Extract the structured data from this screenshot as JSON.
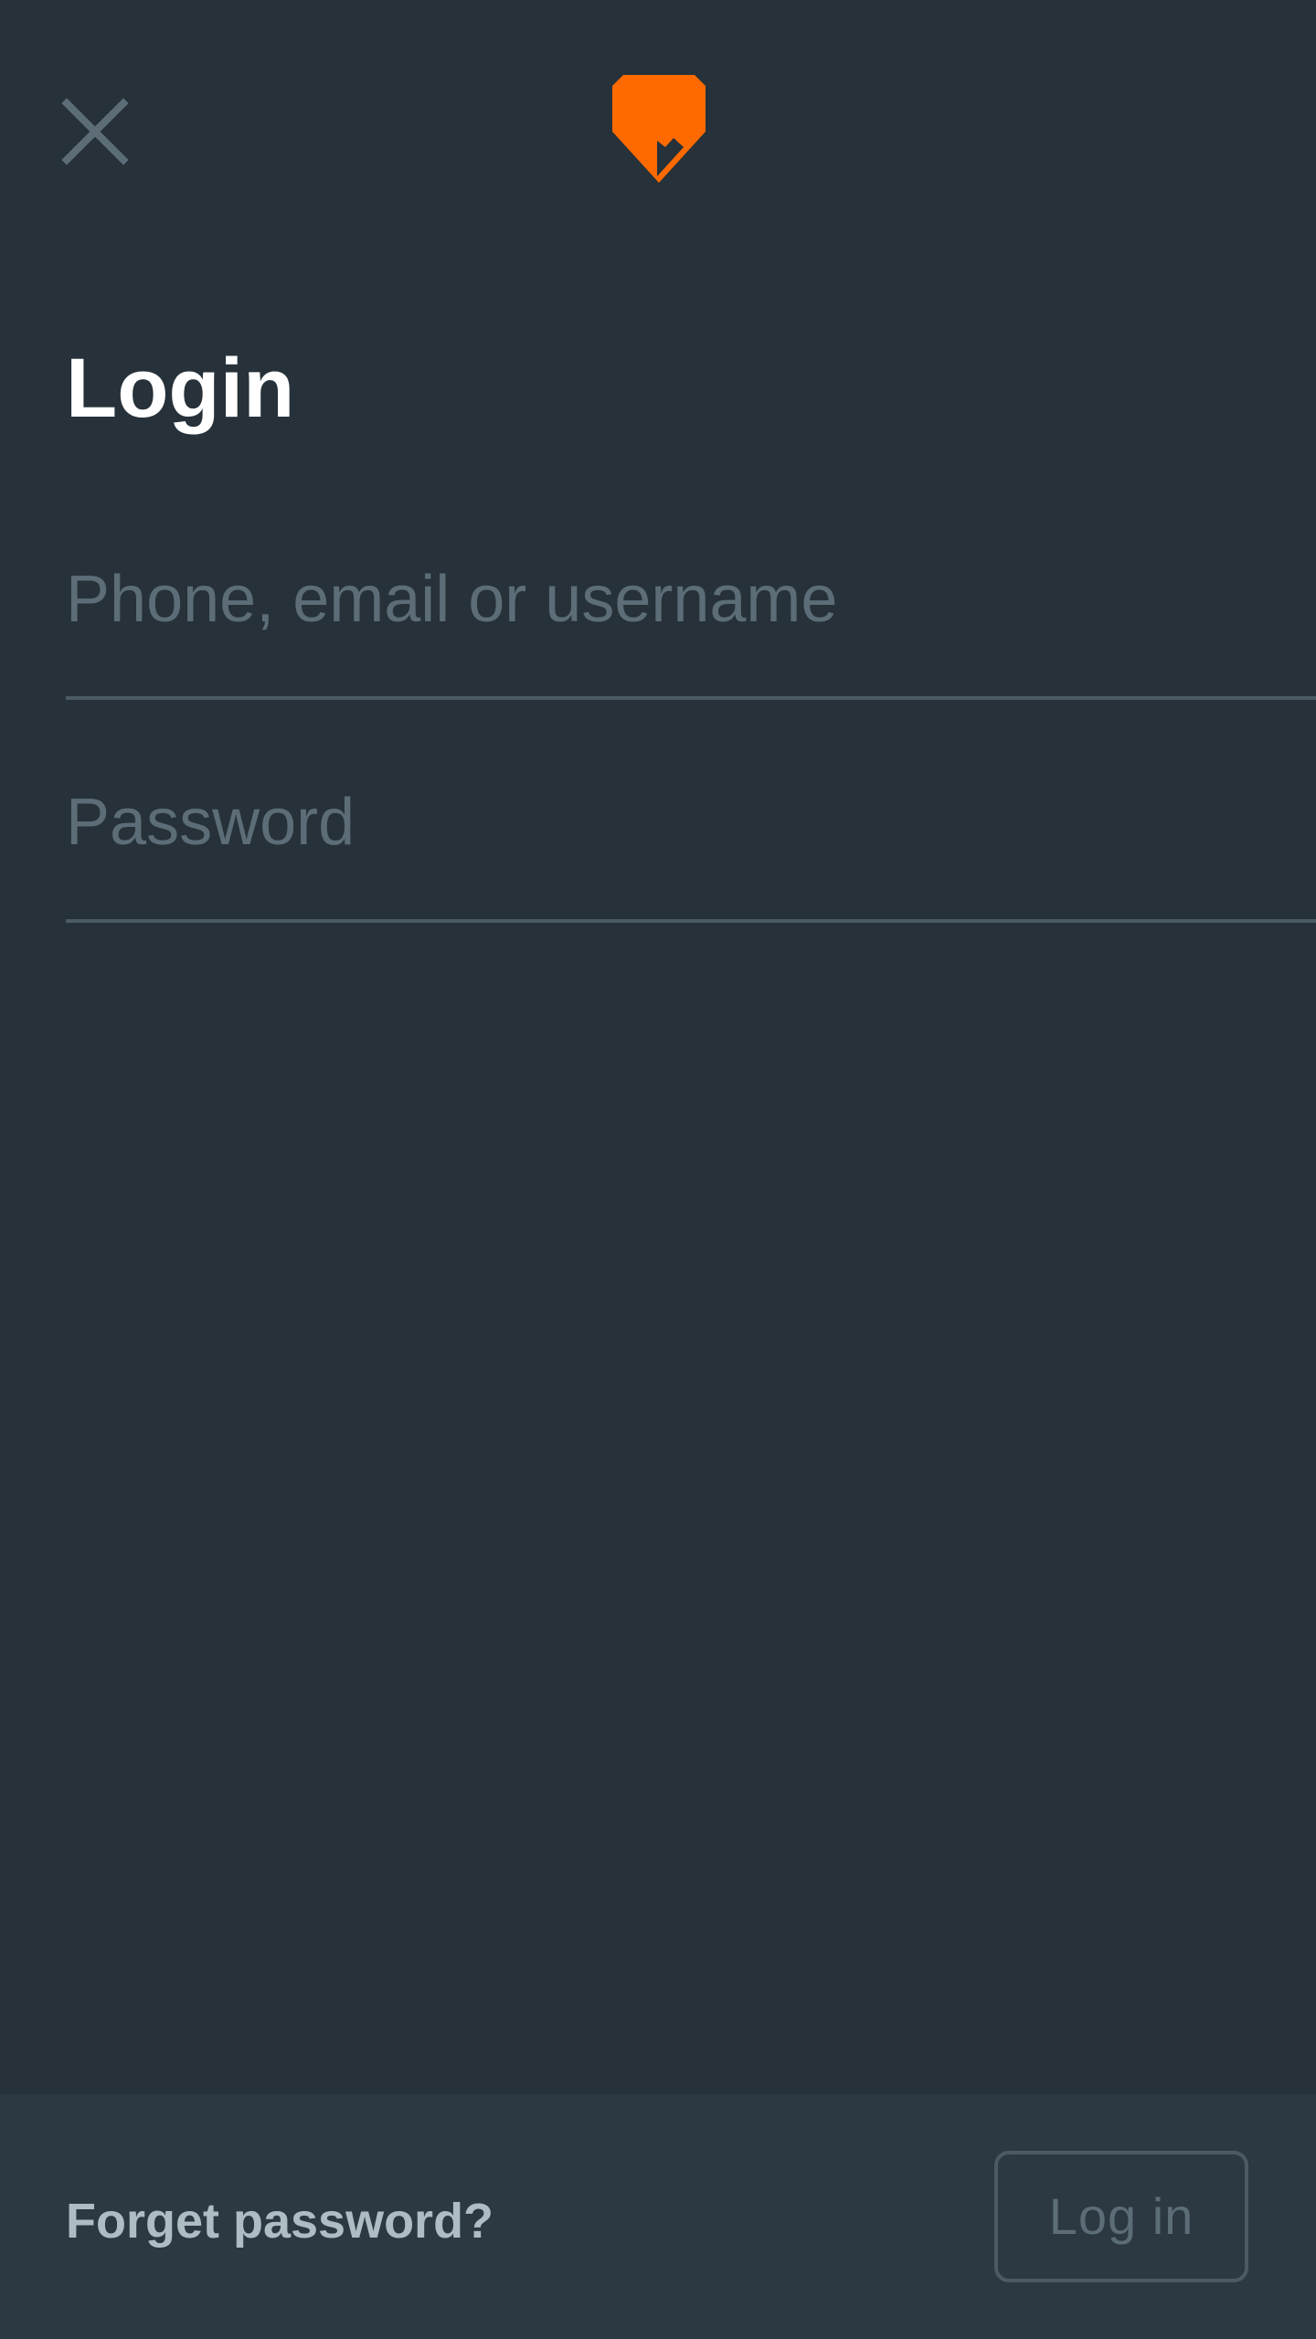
{
  "header": {
    "close_icon": "close-icon",
    "logo_icon": "orange-shield-logo-icon",
    "logo_color": "#FF6A00"
  },
  "main": {
    "title": "Login",
    "identifier_field": {
      "placeholder": "Phone, email or username",
      "value": ""
    },
    "password_field": {
      "placeholder": "Password",
      "value": ""
    }
  },
  "footer": {
    "forgot_password": "Forget password?",
    "login_button": "Log in"
  },
  "colors": {
    "background": "#263139",
    "footer_background": "#2C3942",
    "muted_text": "#5C6D77",
    "link_text": "#AEBCC3",
    "divider": "#4B5A63"
  }
}
